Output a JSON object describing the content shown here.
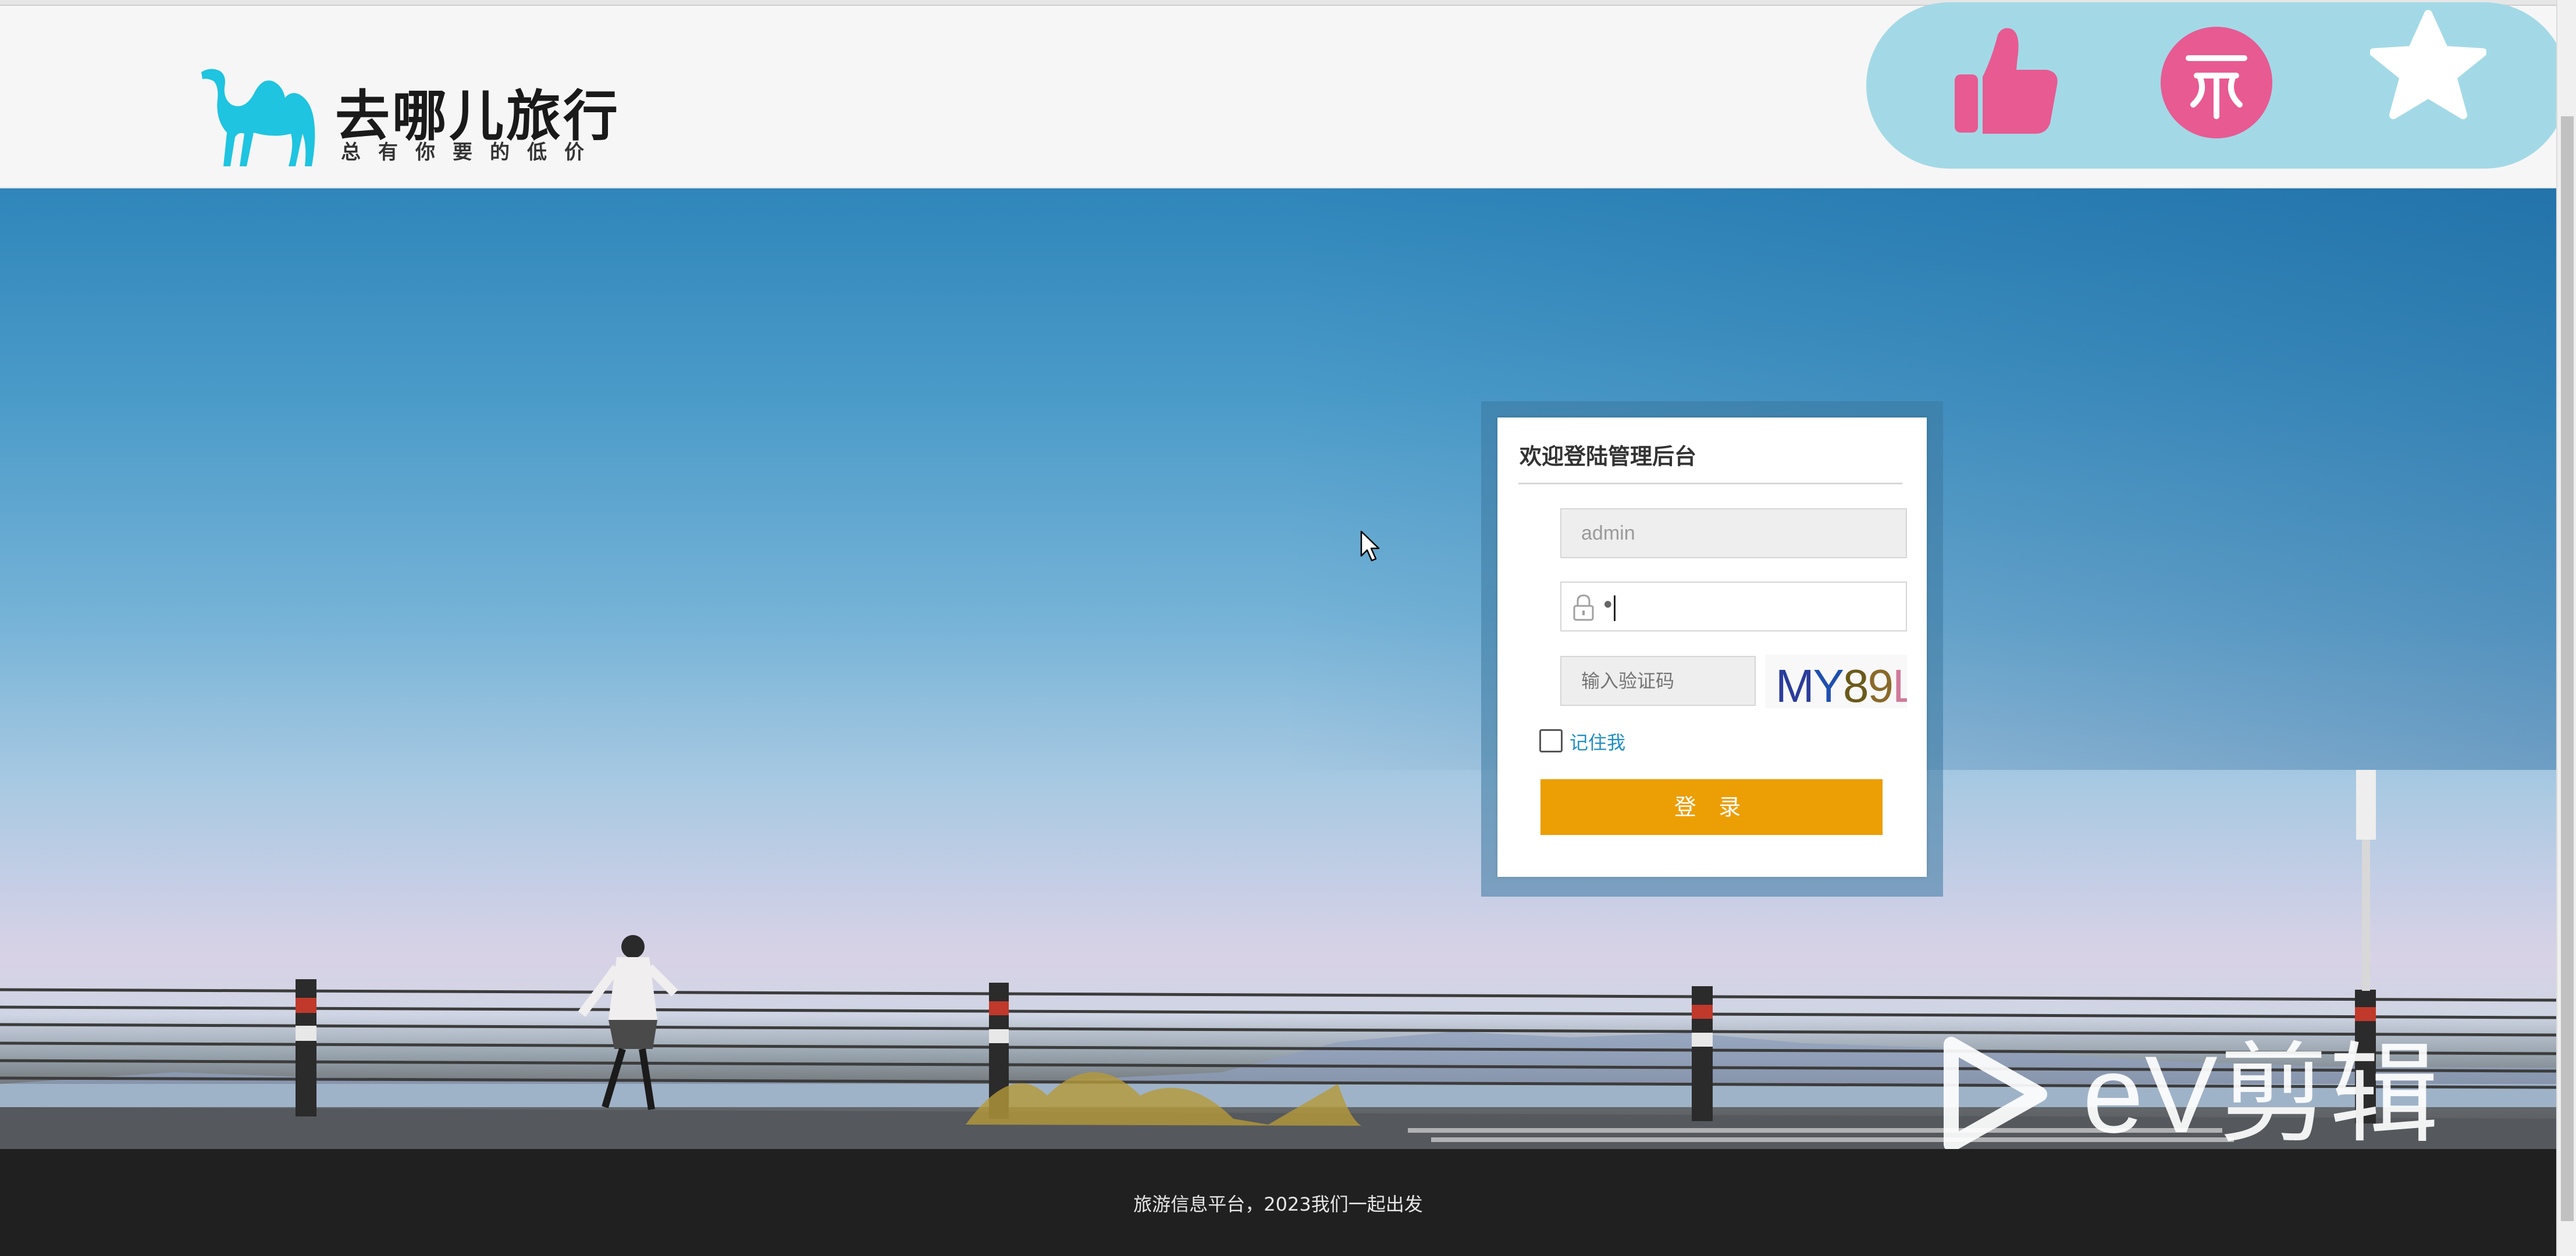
{
  "header": {
    "logo_title": "去哪儿旅行",
    "logo_slogan": "总有你要的低价"
  },
  "action_bar": {
    "icons": [
      "thumbs-up-icon",
      "coin-icon",
      "star-icon"
    ],
    "icon_color": "#e85a92",
    "star_color": "#ffffff",
    "background": "#a3d9e6"
  },
  "login": {
    "title": "欢迎登陆管理后台",
    "username_value": "admin",
    "password_mask": "•",
    "captcha_placeholder": "输入验证码",
    "captcha_code": "MY89L",
    "remember_label": "记住我",
    "submit_label": "登 录",
    "accent_color": "#ec9e05"
  },
  "watermark": {
    "text": "eV剪辑"
  },
  "footer": {
    "text": "旅游信息平台，2023我们一起出发"
  }
}
